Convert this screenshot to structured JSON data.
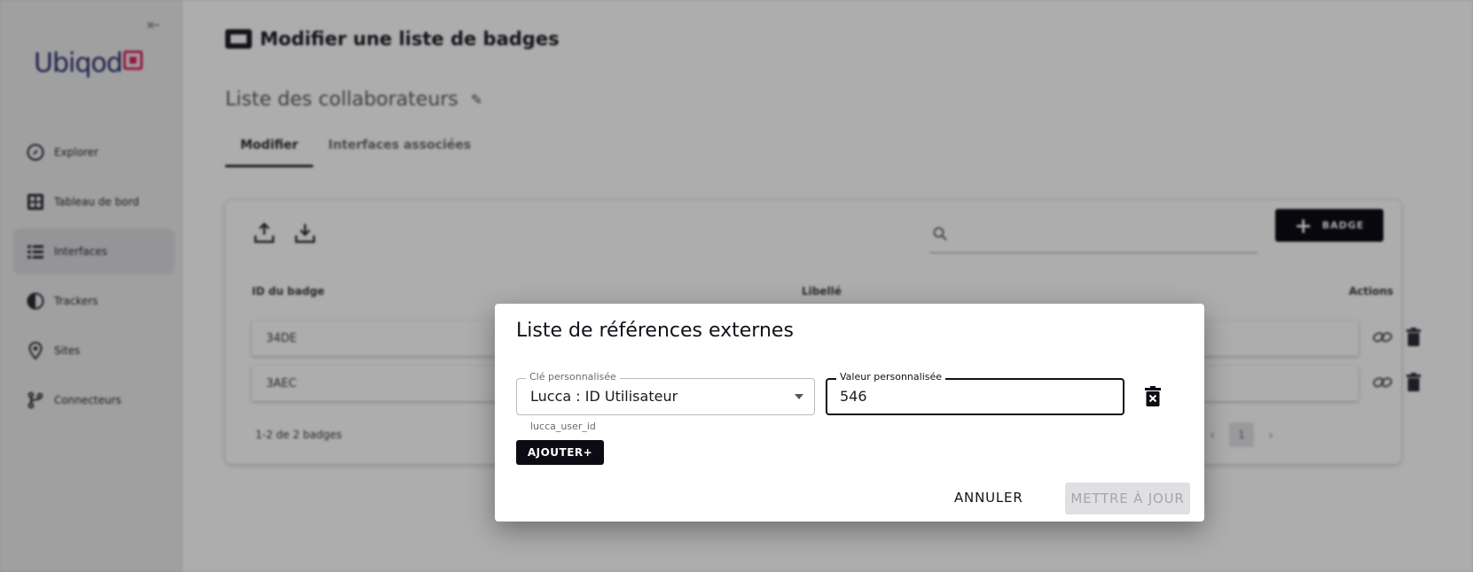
{
  "sidebar": {
    "logo": "Ubiqod",
    "items": [
      {
        "label": "Explorer",
        "icon": "compass-icon"
      },
      {
        "label": "Tableau de bord",
        "icon": "dashboard-icon"
      },
      {
        "label": "Interfaces",
        "icon": "list-icon",
        "active": true
      },
      {
        "label": "Trackers",
        "icon": "half-circle-icon"
      },
      {
        "label": "Sites",
        "icon": "location-pin-icon"
      },
      {
        "label": "Connecteurs",
        "icon": "branch-icon"
      }
    ]
  },
  "page": {
    "title": "Modifier une liste de badges",
    "list_name": "Liste des collaborateurs",
    "tabs": [
      "Modifier",
      "Interfaces associées"
    ]
  },
  "table": {
    "add_badge_label": "BADGE",
    "columns": [
      "ID du badge",
      "Libellé",
      "Actions"
    ],
    "rows": [
      {
        "id": "34DE"
      },
      {
        "id": "3AEC"
      }
    ],
    "count_text": "1-2 de 2 badges",
    "current_page": "1"
  },
  "dialog": {
    "title": "Liste de références externes",
    "key_label": "Clé personnalisée",
    "key_value": "Lucca : ID Utilisateur",
    "key_helper": "lucca_user_id",
    "value_label": "Valeur personnalisée",
    "value_value": "546",
    "add_label": "AJOUTER+",
    "cancel_label": "ANNULER",
    "update_label": "METTRE À JOUR"
  }
}
